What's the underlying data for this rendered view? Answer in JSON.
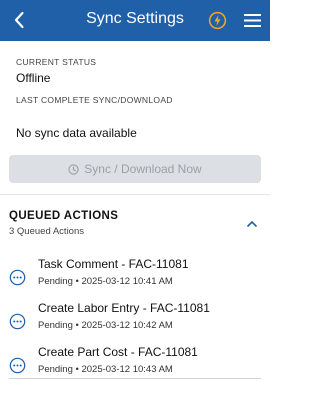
{
  "header": {
    "title": "Sync Settings",
    "back_icon": "chevron-left-icon",
    "bolt_icon": "lightning-bolt-icon",
    "menu_icon": "hamburger-menu-icon",
    "background_color": "#1f60a8",
    "bolt_color": "#f5a623"
  },
  "status": {
    "current_status_label": "CURRENT STATUS",
    "current_status_value": "Offline",
    "last_sync_label": "LAST COMPLETE SYNC/DOWNLOAD",
    "last_sync_value": "No sync data available",
    "sync_button_label": "Sync / Download Now",
    "sync_button_icon": "sync-clock-icon"
  },
  "queue": {
    "title": "QUEUED ACTIONS",
    "count_label": "3 Queued Actions",
    "collapse_icon": "chevron-up-icon",
    "items": [
      {
        "name": "Task Comment - FAC-11081",
        "meta": "Pending • 2025-03-12 10:41 AM",
        "icon": "more-horizontal-circle-icon"
      },
      {
        "name": "Create Labor Entry - FAC-11081",
        "meta": "Pending • 2025-03-12 10:42 AM",
        "icon": "more-horizontal-circle-icon"
      },
      {
        "name": "Create Part Cost - FAC-11081",
        "meta": "Pending • 2025-03-12 10:43 AM",
        "icon": "more-horizontal-circle-icon"
      }
    ]
  }
}
